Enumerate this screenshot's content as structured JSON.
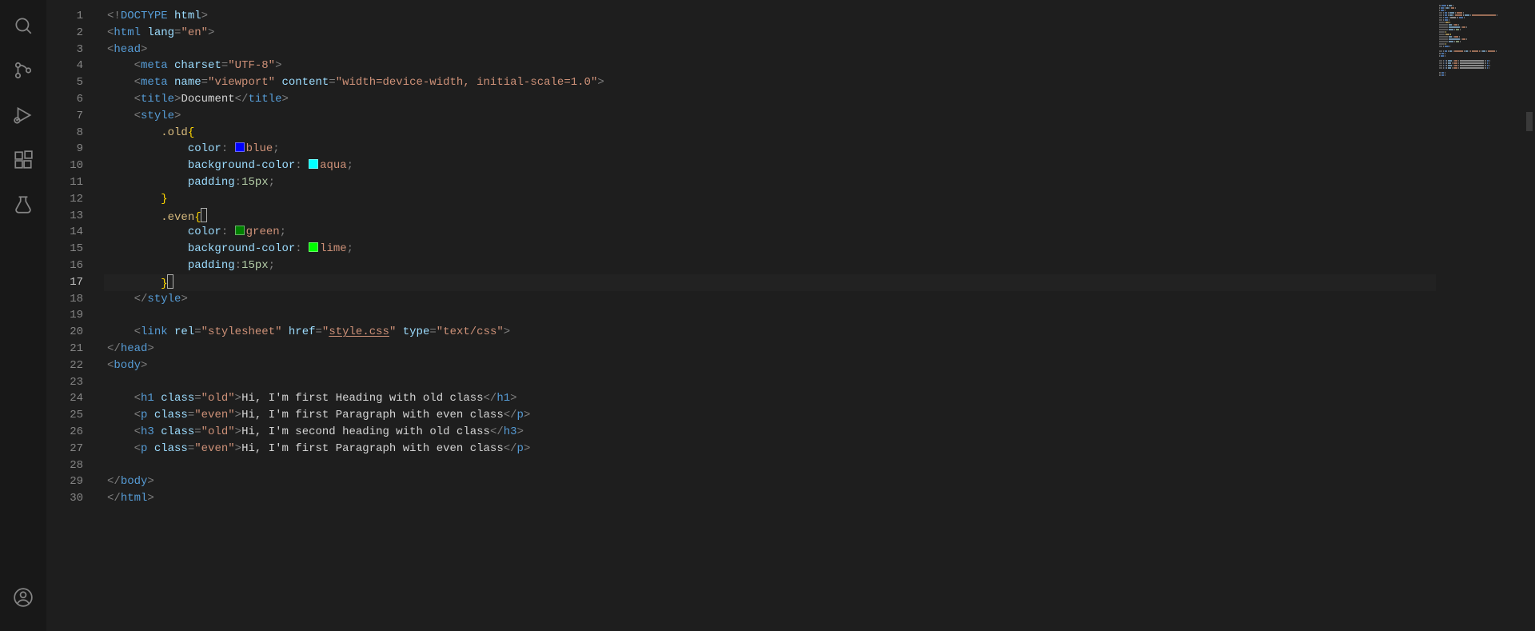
{
  "activity_bar": {
    "icons": [
      {
        "name": "search-icon"
      },
      {
        "name": "source-control-icon"
      },
      {
        "name": "run-debug-icon"
      },
      {
        "name": "extensions-icon"
      },
      {
        "name": "testing-icon"
      }
    ],
    "bottom": {
      "name": "accounts-icon"
    }
  },
  "editor": {
    "total_lines": 30,
    "current_line": 17,
    "lines": {
      "1": [
        {
          "t": "punct",
          "v": "<!"
        },
        {
          "t": "doctype",
          "v": "DOCTYPE"
        },
        {
          "t": "text",
          "v": " "
        },
        {
          "t": "attr",
          "v": "html"
        },
        {
          "t": "punct",
          "v": ">"
        }
      ],
      "2": [
        {
          "t": "punct",
          "v": "<"
        },
        {
          "t": "tag",
          "v": "html"
        },
        {
          "t": "text",
          "v": " "
        },
        {
          "t": "attr",
          "v": "lang"
        },
        {
          "t": "punct",
          "v": "="
        },
        {
          "t": "str",
          "v": "\"en\""
        },
        {
          "t": "punct",
          "v": ">"
        }
      ],
      "3": [
        {
          "t": "punct",
          "v": "<"
        },
        {
          "t": "tag",
          "v": "head"
        },
        {
          "t": "punct",
          "v": ">"
        }
      ],
      "4": [
        {
          "t": "indent",
          "v": "    "
        },
        {
          "t": "punct",
          "v": "<"
        },
        {
          "t": "tag",
          "v": "meta"
        },
        {
          "t": "text",
          "v": " "
        },
        {
          "t": "attr",
          "v": "charset"
        },
        {
          "t": "punct",
          "v": "="
        },
        {
          "t": "str",
          "v": "\"UTF-8\""
        },
        {
          "t": "punct",
          "v": ">"
        }
      ],
      "5": [
        {
          "t": "indent",
          "v": "    "
        },
        {
          "t": "punct",
          "v": "<"
        },
        {
          "t": "tag",
          "v": "meta"
        },
        {
          "t": "text",
          "v": " "
        },
        {
          "t": "attr",
          "v": "name"
        },
        {
          "t": "punct",
          "v": "="
        },
        {
          "t": "str",
          "v": "\"viewport\""
        },
        {
          "t": "text",
          "v": " "
        },
        {
          "t": "attr",
          "v": "content"
        },
        {
          "t": "punct",
          "v": "="
        },
        {
          "t": "str",
          "v": "\"width=device-width, initial-scale=1.0\""
        },
        {
          "t": "punct",
          "v": ">"
        }
      ],
      "6": [
        {
          "t": "indent",
          "v": "    "
        },
        {
          "t": "punct",
          "v": "<"
        },
        {
          "t": "tag",
          "v": "title"
        },
        {
          "t": "punct",
          "v": ">"
        },
        {
          "t": "text",
          "v": "Document"
        },
        {
          "t": "punct",
          "v": "</"
        },
        {
          "t": "tag",
          "v": "title"
        },
        {
          "t": "punct",
          "v": ">"
        }
      ],
      "7": [
        {
          "t": "indent",
          "v": "    "
        },
        {
          "t": "punct",
          "v": "<"
        },
        {
          "t": "tag",
          "v": "style"
        },
        {
          "t": "punct",
          "v": ">"
        }
      ],
      "8": [
        {
          "t": "indent",
          "v": "        "
        },
        {
          "t": "selector",
          "v": ".old"
        },
        {
          "t": "brace",
          "v": "{"
        }
      ],
      "9": [
        {
          "t": "indent",
          "v": "            "
        },
        {
          "t": "prop",
          "v": "color"
        },
        {
          "t": "punct",
          "v": ":"
        },
        {
          "t": "swatch",
          "color": "#0000ff"
        },
        {
          "t": "val",
          "v": "blue"
        },
        {
          "t": "punct",
          "v": ";"
        }
      ],
      "10": [
        {
          "t": "indent",
          "v": "            "
        },
        {
          "t": "prop",
          "v": "background-color"
        },
        {
          "t": "punct",
          "v": ":"
        },
        {
          "t": "swatch",
          "color": "#00ffff"
        },
        {
          "t": "val",
          "v": "aqua"
        },
        {
          "t": "punct",
          "v": ";"
        }
      ],
      "11": [
        {
          "t": "indent",
          "v": "            "
        },
        {
          "t": "prop",
          "v": "padding"
        },
        {
          "t": "punct",
          "v": ":"
        },
        {
          "t": "num",
          "v": "15px"
        },
        {
          "t": "punct",
          "v": ";"
        }
      ],
      "12": [
        {
          "t": "indent",
          "v": "        "
        },
        {
          "t": "brace",
          "v": "}"
        }
      ],
      "13": [
        {
          "t": "indent",
          "v": "        "
        },
        {
          "t": "selector",
          "v": ".even"
        },
        {
          "t": "brace",
          "v": "{"
        },
        {
          "t": "cursorbox",
          "v": ""
        }
      ],
      "14": [
        {
          "t": "indent",
          "v": "            "
        },
        {
          "t": "prop",
          "v": "color"
        },
        {
          "t": "punct",
          "v": ":"
        },
        {
          "t": "swatch",
          "color": "#008000"
        },
        {
          "t": "val",
          "v": "green"
        },
        {
          "t": "punct",
          "v": ";"
        }
      ],
      "15": [
        {
          "t": "indent",
          "v": "            "
        },
        {
          "t": "prop",
          "v": "background-color"
        },
        {
          "t": "punct",
          "v": ":"
        },
        {
          "t": "swatch",
          "color": "#00ff00"
        },
        {
          "t": "val",
          "v": "lime"
        },
        {
          "t": "punct",
          "v": ";"
        }
      ],
      "16": [
        {
          "t": "indent",
          "v": "            "
        },
        {
          "t": "prop",
          "v": "padding"
        },
        {
          "t": "punct",
          "v": ":"
        },
        {
          "t": "num",
          "v": "15px"
        },
        {
          "t": "punct",
          "v": ";"
        }
      ],
      "17": [
        {
          "t": "indent",
          "v": "        "
        },
        {
          "t": "brace",
          "v": "}"
        },
        {
          "t": "cursorbox",
          "v": ""
        }
      ],
      "18": [
        {
          "t": "indent",
          "v": "    "
        },
        {
          "t": "punct",
          "v": "</"
        },
        {
          "t": "tag",
          "v": "style"
        },
        {
          "t": "punct",
          "v": ">"
        }
      ],
      "19": [],
      "20": [
        {
          "t": "indent",
          "v": "    "
        },
        {
          "t": "punct",
          "v": "<"
        },
        {
          "t": "tag",
          "v": "link"
        },
        {
          "t": "text",
          "v": " "
        },
        {
          "t": "attr",
          "v": "rel"
        },
        {
          "t": "punct",
          "v": "="
        },
        {
          "t": "str",
          "v": "\"stylesheet\""
        },
        {
          "t": "text",
          "v": " "
        },
        {
          "t": "attr",
          "v": "href"
        },
        {
          "t": "punct",
          "v": "="
        },
        {
          "t": "str",
          "v": "\""
        },
        {
          "t": "str underline",
          "v": "style.css"
        },
        {
          "t": "str",
          "v": "\""
        },
        {
          "t": "text",
          "v": " "
        },
        {
          "t": "attr",
          "v": "type"
        },
        {
          "t": "punct",
          "v": "="
        },
        {
          "t": "str",
          "v": "\"text/css\""
        },
        {
          "t": "punct",
          "v": ">"
        }
      ],
      "21": [
        {
          "t": "punct",
          "v": "</"
        },
        {
          "t": "tag",
          "v": "head"
        },
        {
          "t": "punct",
          "v": ">"
        }
      ],
      "22": [
        {
          "t": "punct",
          "v": "<"
        },
        {
          "t": "tag",
          "v": "body"
        },
        {
          "t": "punct",
          "v": ">"
        }
      ],
      "23": [],
      "24": [
        {
          "t": "indent",
          "v": "    "
        },
        {
          "t": "punct",
          "v": "<"
        },
        {
          "t": "tag",
          "v": "h1"
        },
        {
          "t": "text",
          "v": " "
        },
        {
          "t": "attr",
          "v": "class"
        },
        {
          "t": "punct",
          "v": "="
        },
        {
          "t": "str",
          "v": "\"old\""
        },
        {
          "t": "punct",
          "v": ">"
        },
        {
          "t": "text",
          "v": "Hi, I'm first Heading with old class"
        },
        {
          "t": "punct",
          "v": "</"
        },
        {
          "t": "tag",
          "v": "h1"
        },
        {
          "t": "punct",
          "v": ">"
        }
      ],
      "25": [
        {
          "t": "indent",
          "v": "    "
        },
        {
          "t": "punct",
          "v": "<"
        },
        {
          "t": "tag",
          "v": "p"
        },
        {
          "t": "text",
          "v": " "
        },
        {
          "t": "attr",
          "v": "class"
        },
        {
          "t": "punct",
          "v": "="
        },
        {
          "t": "str",
          "v": "\"even\""
        },
        {
          "t": "punct",
          "v": ">"
        },
        {
          "t": "text",
          "v": "Hi, I'm first Paragraph with even class"
        },
        {
          "t": "punct",
          "v": "</"
        },
        {
          "t": "tag",
          "v": "p"
        },
        {
          "t": "punct",
          "v": ">"
        }
      ],
      "26": [
        {
          "t": "indent",
          "v": "    "
        },
        {
          "t": "punct",
          "v": "<"
        },
        {
          "t": "tag",
          "v": "h3"
        },
        {
          "t": "text",
          "v": " "
        },
        {
          "t": "attr",
          "v": "class"
        },
        {
          "t": "punct",
          "v": "="
        },
        {
          "t": "str",
          "v": "\"old\""
        },
        {
          "t": "punct",
          "v": ">"
        },
        {
          "t": "text",
          "v": "Hi, I'm second heading with old class"
        },
        {
          "t": "punct",
          "v": "</"
        },
        {
          "t": "tag",
          "v": "h3"
        },
        {
          "t": "punct",
          "v": ">"
        }
      ],
      "27": [
        {
          "t": "indent",
          "v": "    "
        },
        {
          "t": "punct",
          "v": "<"
        },
        {
          "t": "tag",
          "v": "p"
        },
        {
          "t": "text",
          "v": " "
        },
        {
          "t": "attr",
          "v": "class"
        },
        {
          "t": "punct",
          "v": "="
        },
        {
          "t": "str",
          "v": "\"even\""
        },
        {
          "t": "punct",
          "v": ">"
        },
        {
          "t": "text",
          "v": "Hi, I'm first Paragraph with even class"
        },
        {
          "t": "punct",
          "v": "</"
        },
        {
          "t": "tag",
          "v": "p"
        },
        {
          "t": "punct",
          "v": ">"
        }
      ],
      "28": [],
      "29": [
        {
          "t": "punct",
          "v": "</"
        },
        {
          "t": "tag",
          "v": "body"
        },
        {
          "t": "punct",
          "v": ">"
        }
      ],
      "30": [
        {
          "t": "punct",
          "v": "</"
        },
        {
          "t": "tag",
          "v": "html"
        },
        {
          "t": "punct",
          "v": ">"
        }
      ]
    }
  }
}
